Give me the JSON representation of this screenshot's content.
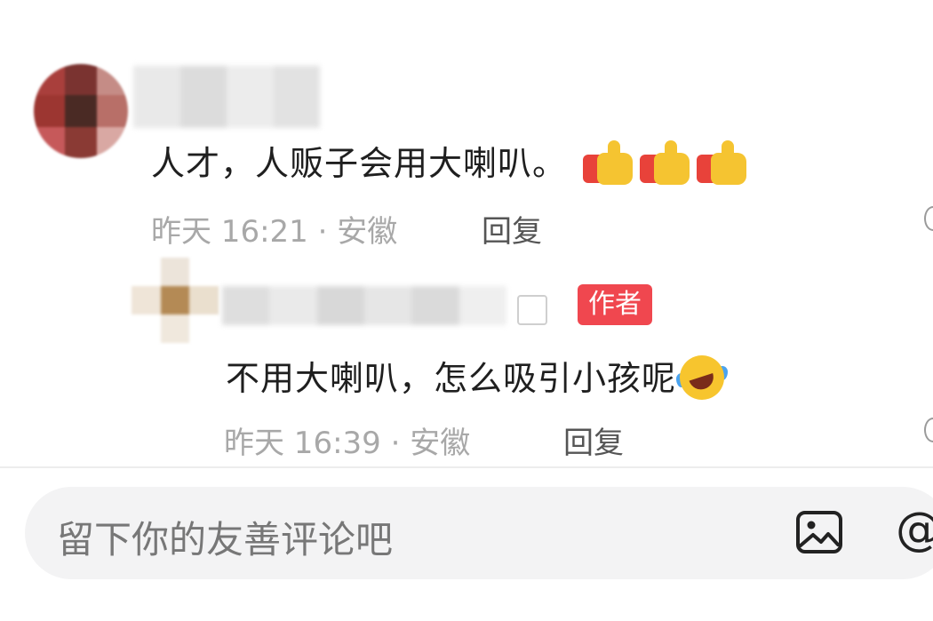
{
  "comments": [
    {
      "text": "人才，人贩子会用大喇叭。",
      "meta": "昨天 16:21 · 安徽",
      "reply_label": "回复",
      "emoji": "thumbs-up-x3"
    },
    {
      "badge": "作者",
      "text": "不用大喇叭，怎么吸引小孩呢",
      "meta": "昨天 16:39 · 安徽",
      "reply_label": "回复",
      "emoji": "rolling-laugh"
    }
  ],
  "composer": {
    "placeholder": "留下你的友善评论吧",
    "image_icon": "image-icon",
    "mention_label": "@"
  },
  "colors": {
    "badge_bg": "#f0474f",
    "meta_text": "#a8a8a8",
    "input_bg": "#f3f3f4"
  }
}
